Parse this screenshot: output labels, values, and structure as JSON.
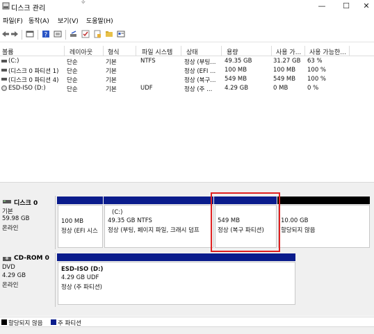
{
  "window": {
    "title": "디스크 관리",
    "caret": "✧",
    "min": "—",
    "max": "☐",
    "close": "✕"
  },
  "menu": [
    "파일(F)",
    "동작(A)",
    "보기(V)",
    "도움말(H)"
  ],
  "toolbar_icons": [
    "back-icon",
    "forward-icon",
    "console-icon",
    "help-icon",
    "properties-icon",
    "disk-icon",
    "check-icon",
    "new-volume-icon",
    "open-folder-icon",
    "details-icon"
  ],
  "table": {
    "columns": [
      "볼륨",
      "레이아웃",
      "형식",
      "파일 시스템",
      "상태",
      "용량",
      "사용 가...",
      "사용 가능한..."
    ],
    "rows": [
      [
        "(C:)",
        "단순",
        "기본",
        "NTFS",
        "정상 (부팅...",
        "49.35 GB",
        "31.27 GB",
        "63 %"
      ],
      [
        "(디스크 0 파티션 1)",
        "단순",
        "기본",
        "",
        "정상 (EFI ...",
        "100 MB",
        "100 MB",
        "100 %"
      ],
      [
        "(디스크 0 파티션 4)",
        "단순",
        "기본",
        "",
        "정상 (복구...",
        "549 MB",
        "549 MB",
        "100 %"
      ],
      [
        "ESD-ISO (D:)",
        "단순",
        "기본",
        "UDF",
        "정상 (주 ...",
        "4.29 GB",
        "0 MB",
        "0 %"
      ]
    ]
  },
  "disks": [
    {
      "name": "디스크 0",
      "type": "기본",
      "size": "59.98 GB",
      "status": "온라인",
      "partitions": [
        {
          "line1": "",
          "line2": "100 MB",
          "line3": "정상 (EFI 시스"
        },
        {
          "line1": "(C:)",
          "line2": "49.35 GB NTFS",
          "line3": "정상 (부팅, 페이지 파일, 크래시 덤프"
        },
        {
          "line1": "",
          "line2": "549 MB",
          "line3": "정상 (복구 파티션)"
        },
        {
          "line1": "",
          "line2": "10.00 GB",
          "line3": "할당되지 않음"
        }
      ]
    },
    {
      "name": "CD-ROM 0",
      "type": "DVD",
      "size": "4.29 GB",
      "status": "온라인",
      "partitions": [
        {
          "line1": "ESD-ISO  (D:)",
          "line2": "4.29 GB UDF",
          "line3": "정상 (주 파티션)"
        }
      ]
    }
  ],
  "legend": [
    {
      "label": "할당되지 않음",
      "color": "#000000"
    },
    {
      "label": "주 파티션",
      "color": "#0a1c8c"
    }
  ],
  "highlight_color": "#e02020"
}
